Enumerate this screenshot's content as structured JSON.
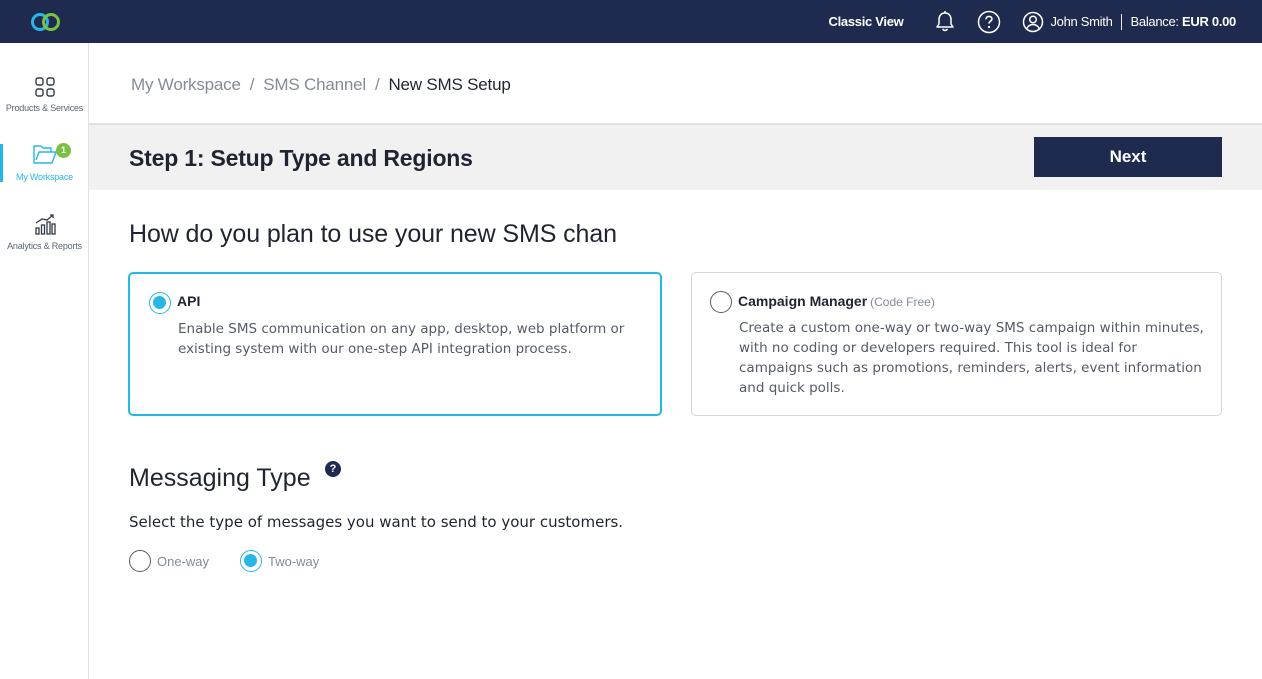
{
  "topbar": {
    "classic_view": "Classic View",
    "user_name": "John Smith",
    "balance_label": "Balance:",
    "balance_value": "EUR 0.00"
  },
  "sidebar": {
    "items": [
      {
        "label": "Products & Services",
        "icon": "grid-icon"
      },
      {
        "label": "My Workspace",
        "icon": "folder-icon",
        "badge": "1",
        "active": true
      },
      {
        "label": "Analytics & Reports",
        "icon": "chart-icon"
      }
    ]
  },
  "breadcrumb": {
    "items": [
      "My Workspace",
      "SMS Channel",
      "New SMS Setup"
    ],
    "separator": "/"
  },
  "step": {
    "title": "Step 1: Setup Type and Regions",
    "next_label": "Next"
  },
  "question": "How do you plan to use your new SMS chan",
  "cards": [
    {
      "title": "API",
      "subtitle": "",
      "description": "Enable SMS communication on any app, desktop, web platform or existing system with our one-step API integration process.",
      "selected": true
    },
    {
      "title": "Campaign Manager",
      "subtitle": "(Code Free)",
      "description": "Create a custom one-way or two-way SMS campaign within minutes, with no coding or developers required. This tool is ideal for campaigns such as promotions, reminders, alerts, event information and quick polls.",
      "selected": false
    }
  ],
  "messaging": {
    "title": "Messaging Type",
    "help": "?",
    "description": "Select the type of messages you want to send to your customers.",
    "options": [
      {
        "label": "One-way",
        "selected": false
      },
      {
        "label": "Two-way",
        "selected": true
      }
    ]
  },
  "colors": {
    "navy": "#1e2b4e",
    "accent": "#27b7e6",
    "badge_green": "#7ac142"
  }
}
